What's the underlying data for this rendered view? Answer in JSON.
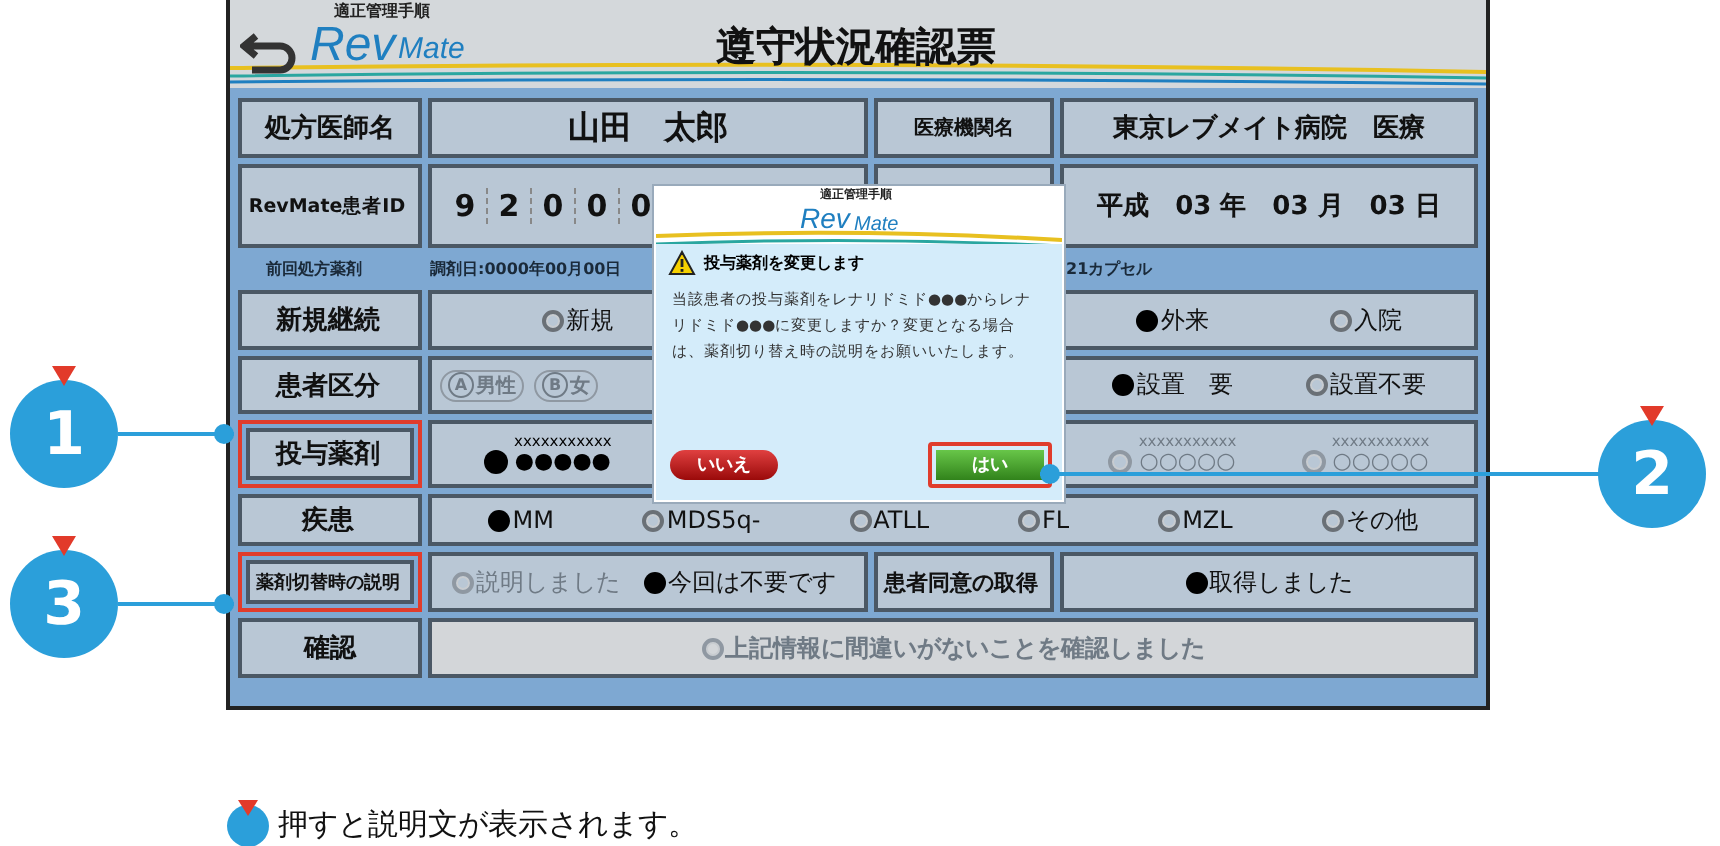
{
  "header": {
    "subtitle": "適正管理手順",
    "logo": {
      "part1": "Rev",
      "part2": "Mate"
    },
    "title": "遵守状況確認票"
  },
  "prescriber": {
    "label": "処方医師名",
    "value": "山田　太郎"
  },
  "institution": {
    "label": "医療機関名",
    "value": "東京レブメイト病院　医療"
  },
  "patient_id": {
    "label": "RevMate患者ID",
    "digits": [
      "9",
      "2",
      "0",
      "0",
      "0"
    ]
  },
  "date": {
    "value": "平成　03 年　03 月　03 日"
  },
  "previous": {
    "label": "前回処方薬剤",
    "dispensed": "調剤日:0000年00月00日",
    "dose": "21カプセル"
  },
  "rows": [
    {
      "label": "新規継続",
      "highlighted": false,
      "kind": "split",
      "left": [
        {
          "kind": "radio",
          "text": "新規",
          "selected": false,
          "disabled": false
        }
      ],
      "right": [
        {
          "kind": "radio",
          "text": "外来",
          "selected": true,
          "disabled": false
        },
        {
          "kind": "radio",
          "text": "入院",
          "selected": false,
          "disabled": false
        }
      ]
    },
    {
      "label": "患者区分",
      "highlighted": false,
      "kind": "split",
      "left": [
        {
          "kind": "pill",
          "letter": "A",
          "text": "男性",
          "selected": false,
          "disabled": true
        },
        {
          "kind": "pill",
          "letter": "B",
          "text": "女",
          "selected": false,
          "disabled": true
        }
      ],
      "right": [
        {
          "kind": "radio",
          "text": "設置　要",
          "selected": true,
          "disabled": false
        },
        {
          "kind": "radio",
          "text": "設置不要",
          "selected": false,
          "disabled": false
        }
      ]
    },
    {
      "label": "投与薬剤",
      "highlighted": true,
      "kind": "split",
      "left": [
        {
          "kind": "drug",
          "code": "xxxxxxxxxxx",
          "name": "●●●●●",
          "selected": true,
          "disabled": false
        }
      ],
      "right": [
        {
          "kind": "drug",
          "code": "xxxxxxxxxxx",
          "name": "○○○○○",
          "selected": false,
          "disabled": true
        },
        {
          "kind": "drug",
          "code": "xxxxxxxxxxx",
          "name": "○○○○○",
          "selected": false,
          "disabled": true
        }
      ]
    },
    {
      "label": "疾患",
      "highlighted": false,
      "kind": "full",
      "left": [
        {
          "kind": "radio",
          "text": "MM",
          "selected": true,
          "disabled": false
        },
        {
          "kind": "radio",
          "text": "MDS5q-",
          "selected": false,
          "disabled": false
        },
        {
          "kind": "radio",
          "text": "ATLL",
          "selected": false,
          "disabled": false
        },
        {
          "kind": "radio",
          "text": "FL",
          "selected": false,
          "disabled": false
        },
        {
          "kind": "radio",
          "text": "MZL",
          "selected": false,
          "disabled": false
        },
        {
          "kind": "radio",
          "text": "その他",
          "selected": false,
          "disabled": false
        }
      ]
    },
    {
      "label": "薬剤切替時の説明",
      "highlighted": true,
      "kind": "labeled",
      "left": [
        {
          "kind": "radio",
          "text": "説明しました",
          "selected": false,
          "disabled": true
        },
        {
          "kind": "radio",
          "text": "今回は不要です",
          "selected": true,
          "disabled": false
        }
      ],
      "right_label": "患者同意の取得",
      "right": [
        {
          "kind": "radio",
          "text": "取得しました",
          "selected": true,
          "disabled": false
        }
      ]
    }
  ],
  "confirm": {
    "label": "確認",
    "text": "上記情報に間違いがないことを確認しました",
    "checked": false,
    "disabled": true
  },
  "dialog": {
    "subtitle": "適正管理手順",
    "logo": {
      "part1": "Rev",
      "part2": "Mate"
    },
    "title": "投与薬剤を変更します",
    "message": "当該患者の投与薬剤をレナリドミド●●●からレナリドミド●●●に変更しますか？変更となる場合は、薬剤切り替え時の説明をお願いいたします。",
    "buttons": [
      {
        "kind": "cancel",
        "label": "いいえ",
        "highlighted": false
      },
      {
        "kind": "confirm",
        "label": "はい",
        "highlighted": true
      }
    ]
  },
  "callouts": [
    {
      "number": "1"
    },
    {
      "number": "2"
    },
    {
      "number": "3"
    }
  ],
  "legend": {
    "text": "押すと説明文が表示されます。"
  }
}
